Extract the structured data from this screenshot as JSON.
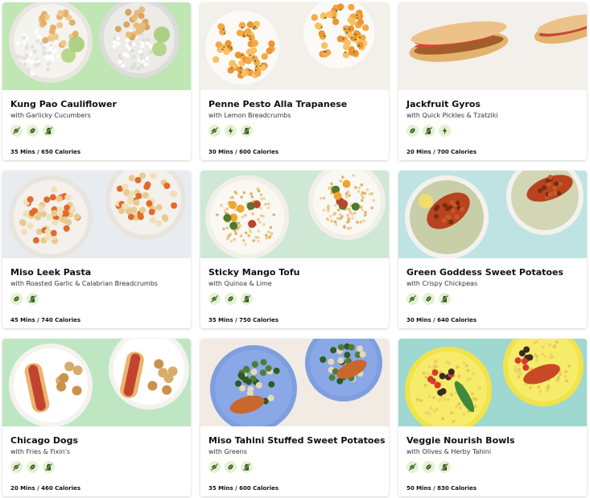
{
  "recipes": [
    {
      "title": "Kung Pao Cauliflower",
      "subtitle": "with Garlicky Cucumbers",
      "meta": "35 Mins / 650 Calories",
      "tags": [
        "no-meat-icon",
        "no-nuts-icon",
        "no-dairy-icon"
      ],
      "bg": "#bfe6b3",
      "style": "rice"
    },
    {
      "title": "Penne Pesto Alla Trapanese",
      "subtitle": "with Lemon Breadcrumbs",
      "meta": "30 Mins / 600 Calories",
      "tags": [
        "no-meat-icon",
        "bolt-icon",
        "no-dairy-icon"
      ],
      "bg": "#f4f0ea",
      "style": "pasta"
    },
    {
      "title": "Jackfruit Gyros",
      "subtitle": "with Quick Pickles & Tzatziki",
      "meta": "20 Mins / 700 Calories",
      "tags": [
        "no-nuts-icon",
        "no-dairy-icon",
        "bolt-icon"
      ],
      "bg": "#f3f0ec",
      "style": "gyro"
    },
    {
      "title": "Miso Leek Pasta",
      "subtitle": "with Roasted Garlic & Calabrian Breadcrumbs",
      "meta": "45 Mins / 740 Calories",
      "tags": [
        "no-nuts-icon",
        "no-dairy-icon"
      ],
      "bg": "#e8ecf0",
      "style": "pasta2"
    },
    {
      "title": "Sticky Mango Tofu",
      "subtitle": "with Quinoa & Lime",
      "meta": "35 Mins / 750 Calories",
      "tags": [
        "no-meat-icon",
        "no-nuts-icon",
        "no-dairy-icon"
      ],
      "bg": "#cfe8d6",
      "style": "quinoa"
    },
    {
      "title": "Green Goddess Sweet Potatoes",
      "subtitle": "with Crispy Chickpeas",
      "meta": "30 Mins / 640 Calories",
      "tags": [
        "no-meat-icon",
        "no-nuts-icon",
        "no-dairy-icon"
      ],
      "bg": "#bfe3e3",
      "style": "sweetpotato"
    },
    {
      "title": "Chicago Dogs",
      "subtitle": "with Fries & Fixin's",
      "meta": "20 Mins / 460 Calories",
      "tags": [
        "no-meat-icon",
        "no-nuts-icon",
        "no-dairy-icon"
      ],
      "bg": "#bfe6c3",
      "style": "hotdog"
    },
    {
      "title": "Miso Tahini Stuffed Sweet Potatoes",
      "subtitle": "with Greens",
      "meta": "35 Mins / 600 Calories",
      "tags": [
        "no-meat-icon",
        "no-nuts-icon",
        "no-dairy-icon"
      ],
      "bg": "#f1ebe4",
      "style": "bluebowl"
    },
    {
      "title": "Veggie Nourish Bowls",
      "subtitle": "with Olives & Herby Tahini",
      "meta": "50 Mins / 830 Calories",
      "tags": [
        "no-meat-icon",
        "no-nuts-icon",
        "no-dairy-icon"
      ],
      "bg": "#9fd8d0",
      "style": "nourish"
    }
  ],
  "colors": {
    "tag_bg": "#e3f2cf",
    "tag_icon": "#2f4f1f"
  }
}
